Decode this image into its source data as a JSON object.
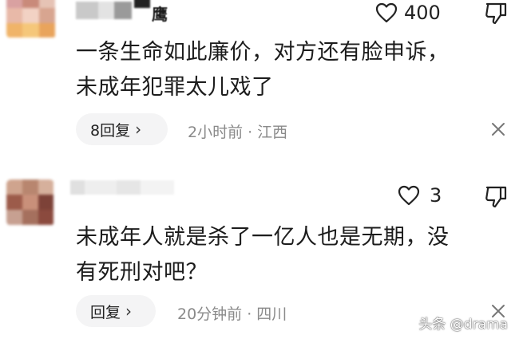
{
  "comments": [
    {
      "username": "鹰",
      "likes": "400",
      "text_line1": "一条生命如此廉价，对方还有脸申诉，",
      "text_line2": "未成年犯罪太儿戏了",
      "reply_label": "8回复",
      "time": "2小时前",
      "location": "江西"
    },
    {
      "username": "",
      "likes": "3",
      "text_line1": "未成年人就是杀了一亿人也是无期，没",
      "text_line2": "有死刑对吧？",
      "reply_label": "回复",
      "time": "20分钟前",
      "location": "四川"
    }
  ],
  "separator": "·",
  "chevron": "›",
  "watermark": "头条 @drama",
  "icons": {
    "like": "heart-outline-icon",
    "dislike": "thumbs-down-icon",
    "close": "close-icon"
  },
  "colors": {
    "meta_text": "#8a8a8a",
    "pill_bg": "#f4f4f5",
    "text": "#1c1c1c"
  }
}
